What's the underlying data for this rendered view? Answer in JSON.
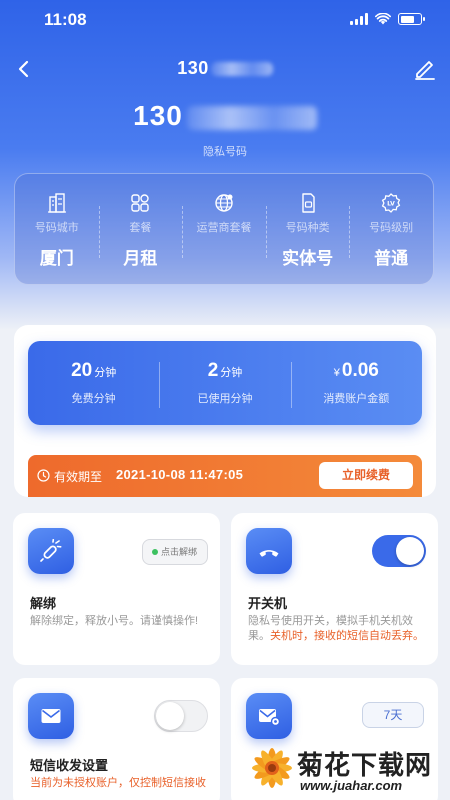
{
  "status_bar": {
    "time": "11:08"
  },
  "header": {
    "title_prefix": "130",
    "phone_prefix": "130",
    "phone_caption": "隐私号码"
  },
  "info": [
    {
      "icon": "building-icon",
      "label": "号码城市",
      "value": "厦门"
    },
    {
      "icon": "grid-icon",
      "label": "套餐",
      "value": "月租"
    },
    {
      "icon": "globe-icon",
      "label": "运营商套餐",
      "value": ""
    },
    {
      "icon": "sim-card-icon",
      "label": "号码种类",
      "value": "实体号"
    },
    {
      "icon": "level-badge-icon",
      "label": "号码级别",
      "value": "普通"
    }
  ],
  "stats": {
    "free": {
      "value": "20",
      "unit": "分钟",
      "label": "免费分钟"
    },
    "used": {
      "value": "2",
      "unit": "分钟",
      "label": "已使用分钟"
    },
    "balance": {
      "currency": "¥",
      "value": "0.06",
      "label": "消费账户金额"
    }
  },
  "expiry": {
    "label": "有效期至",
    "date": "2021-10-08 11:47:05",
    "renew_label": "立即续费"
  },
  "features": {
    "unbind": {
      "title": "解绑",
      "desc": "解除绑定，释放小号。请谨慎操作!",
      "button_label": "点击解绑"
    },
    "power": {
      "title": "开关机",
      "desc": "隐私号使用开关，模拟手机关机效果。",
      "warn": "关机时，接收的短信自动丢弃。",
      "toggle_on": true
    },
    "sms": {
      "title": "短信收发设置",
      "desc": "当前为未授权账户，仅控制短信接收",
      "toggle_on": false
    },
    "msg_settings": {
      "days_label": "7天"
    }
  },
  "watermark": {
    "text": "菊花下载网",
    "url": "www.juahar.com"
  },
  "colors": {
    "primary": "#3a6ae9",
    "accent_orange": "#ee6a2c",
    "toggle_on": "#3a6ae9"
  }
}
